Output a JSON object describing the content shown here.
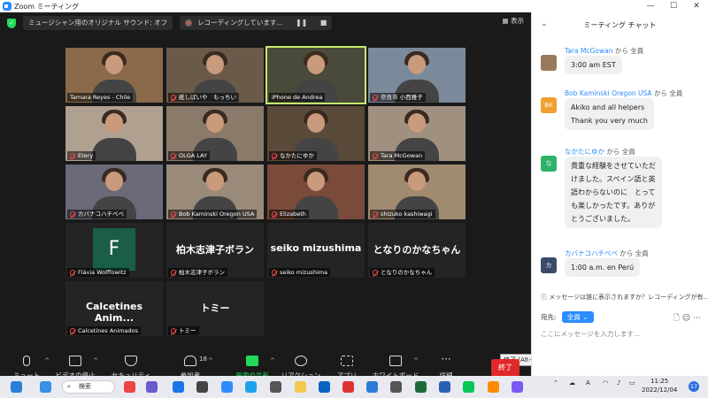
{
  "window": {
    "title": "Zoom ミーティング",
    "minimize": "—",
    "maximize": "☐",
    "close": "✕"
  },
  "topbar": {
    "meeting_audio": "ミュージシャン用のオリジナル サウンド: オフ",
    "recording": "レコーディングしています...",
    "pause": "❚❚",
    "stop": "■",
    "view": "表示"
  },
  "participants": [
    {
      "name": "Tamara Reyes - Chile",
      "muted": false,
      "type": "video"
    },
    {
      "name": "紙しばいや　もっちい",
      "muted": true,
      "type": "video"
    },
    {
      "name": "iPhone de Andrea",
      "muted": false,
      "type": "video",
      "active": true
    },
    {
      "name": "奈良市 小西雅子",
      "muted": true,
      "type": "video"
    },
    {
      "name": "Etery",
      "muted": true,
      "type": "video"
    },
    {
      "name": "OLGA LAY",
      "muted": true,
      "type": "video"
    },
    {
      "name": "なかたにゆか",
      "muted": true,
      "type": "video"
    },
    {
      "name": "Tara McGowan",
      "muted": true,
      "type": "video"
    },
    {
      "name": "カバナコハチベベ",
      "muted": true,
      "type": "video"
    },
    {
      "name": "Bob Kaminski Oregon USA",
      "muted": true,
      "type": "video"
    },
    {
      "name": "Elizabeth",
      "muted": true,
      "type": "video"
    },
    {
      "name": "shizuko kashiwagi",
      "muted": true,
      "type": "video"
    },
    {
      "name": "Flávia Wolffowitz",
      "muted": true,
      "type": "avatar",
      "initial": "F"
    },
    {
      "name": "柏木志津子ボラン",
      "muted": true,
      "type": "name",
      "display": "柏木志津子ボラン"
    },
    {
      "name": "seiko mizushima",
      "muted": true,
      "type": "name",
      "display": "seiko mizushima"
    },
    {
      "name": "となりのかなちゃん",
      "muted": true,
      "type": "name",
      "display": "となりのかなちゃん"
    },
    {
      "name": "Calcetines Animados",
      "muted": true,
      "type": "name",
      "display": "Calcetines  Anim..."
    },
    {
      "name": "トミー",
      "muted": true,
      "type": "name",
      "display": "トミー"
    }
  ],
  "toolbar": {
    "mute": "ミュート",
    "video": "ビデオの停止",
    "security": "セキュリティ",
    "participants": "参加者",
    "participants_count": "18",
    "share": "画面の共有",
    "reactions": "リアクション",
    "apps": "アプリ",
    "whiteboard": "ホワイトボード",
    "more": "詳細",
    "end": "終了",
    "end_tooltip": "終了 (Alt+Q)"
  },
  "chat": {
    "header": "ミーティング チャット",
    "messages": [
      {
        "from": "Tara McGowan",
        "to": "から 全員",
        "lines": [
          "3:00 am EST"
        ],
        "avatar_color": "#9a7a5a",
        "avatar": ""
      },
      {
        "from": "Bob Kaminski Oregon USA",
        "to": "から 全員",
        "lines": [
          "Akiko and all helpers",
          "Thank you very much"
        ],
        "avatar_color": "#f0a030",
        "avatar": "BK"
      },
      {
        "from": "なかたにゆか",
        "to": "から 全員",
        "lines": [
          "貴重な経験をさせていただ",
          "けました。スペイン語と英",
          "語わからないのに　とって",
          "も楽しかったです。ありが",
          "とうございました。"
        ],
        "avatar_color": "#2fb36a",
        "avatar": "な"
      },
      {
        "from": "カバナコハチベベ",
        "to": "から 全員",
        "lines": [
          "1:00 a.m. en Perú"
        ],
        "avatar_color": "#3a4a6a",
        "avatar": "カ"
      }
    ],
    "visibility": "メッセージは誰に表示されますか？レコーディングが有...",
    "send_to_label": "宛先:",
    "send_to_value": "全員",
    "input_placeholder": "ここにメッセージを入力します..."
  },
  "taskbar": {
    "search": "検索",
    "ime": "A",
    "time": "11:25",
    "date": "2022/12/04",
    "notifications": "17"
  }
}
